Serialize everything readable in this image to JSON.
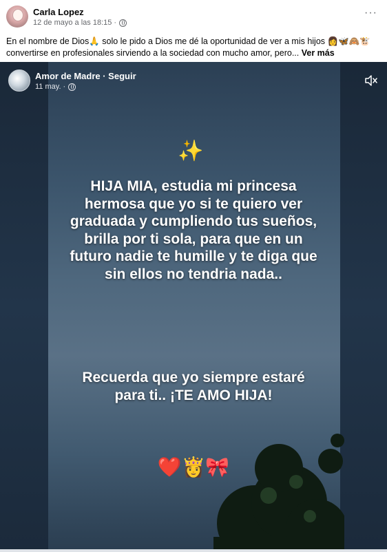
{
  "post": {
    "author": "Carla Lopez",
    "timestamp": "12 de mayo a las 18:15 ·",
    "text": "En el nombre de Dios🙏 solo le pido a Dios me dé la oportunidad de ver a mis hijos 👩🦋🙈🐮 convertirse en profesionales sirviendo  a la sociedad con mucho amor, pero...",
    "see_more": "Ver más",
    "more_icon": "···"
  },
  "shared_video": {
    "page_name": "Amor de Madre · Seguir",
    "date": "11 may. ·",
    "sparkle": "✨",
    "message_1": "HIJA MIA, estudia mi princesa hermosa que yo si te quiero ver graduada y cumpliendo tus sueños, brilla por ti sola, para que en un futuro nadie te humille y te diga que sin ellos no tendria nada..",
    "message_2": "Recuerda que yo siempre estaré para ti.. ¡TE AMO HIJA!",
    "emojis": "❤️👸🎀"
  },
  "icons": {
    "globe": "globe-icon",
    "more": "more-options-icon",
    "mute": "mute-icon"
  }
}
